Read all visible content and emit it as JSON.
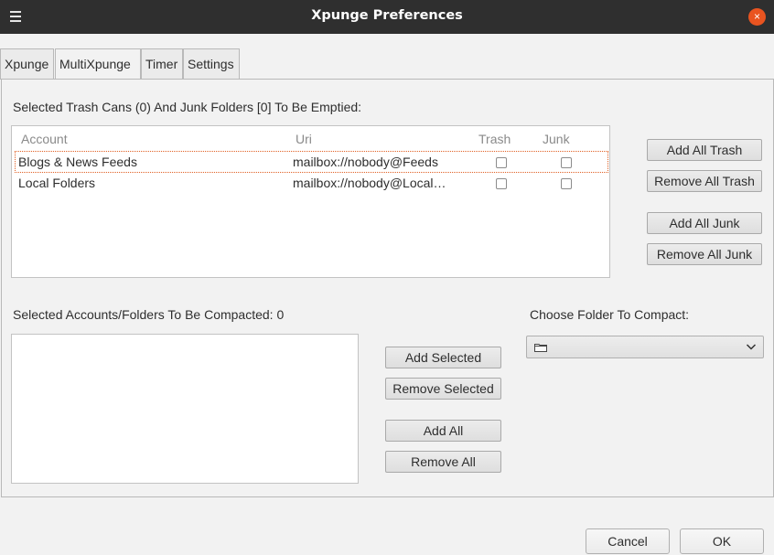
{
  "window": {
    "title": "Xpunge Preferences",
    "menu_icon": "hamburger-menu-icon",
    "close_icon": "close-icon",
    "close_glyph": "×",
    "close_color": "#e95420"
  },
  "tabs": [
    {
      "label": "Xpunge"
    },
    {
      "label": "MultiXpunge"
    },
    {
      "label": "Timer"
    },
    {
      "label": "Settings"
    }
  ],
  "empty_section": {
    "label": "Selected Trash Cans (0) And Junk Folders [0] To Be Emptied:",
    "columns": {
      "account": "Account",
      "uri": "Uri",
      "trash": "Trash",
      "junk": "Junk"
    },
    "rows": [
      {
        "account": "Blogs & News Feeds",
        "uri": "mailbox://nobody@Feeds",
        "trash": false,
        "junk": false
      },
      {
        "account": "Local Folders",
        "uri": "mailbox://nobody@Local…",
        "trash": false,
        "junk": false
      }
    ],
    "buttons": {
      "add_all_trash": "Add All Trash",
      "remove_all_trash": "Remove All Trash",
      "add_all_junk": "Add All Junk",
      "remove_all_junk": "Remove All Junk"
    }
  },
  "compact_section": {
    "label": "Selected Accounts/Folders To Be Compacted: 0",
    "choose_label": "Choose Folder To Compact:",
    "folder_select": {
      "icon": "folder-icon",
      "value": ""
    },
    "buttons": {
      "add_selected": "Add Selected",
      "remove_selected": "Remove Selected",
      "add_all": "Add All",
      "remove_all": "Remove All"
    }
  },
  "dialog_buttons": {
    "cancel": "Cancel",
    "ok": "OK"
  }
}
